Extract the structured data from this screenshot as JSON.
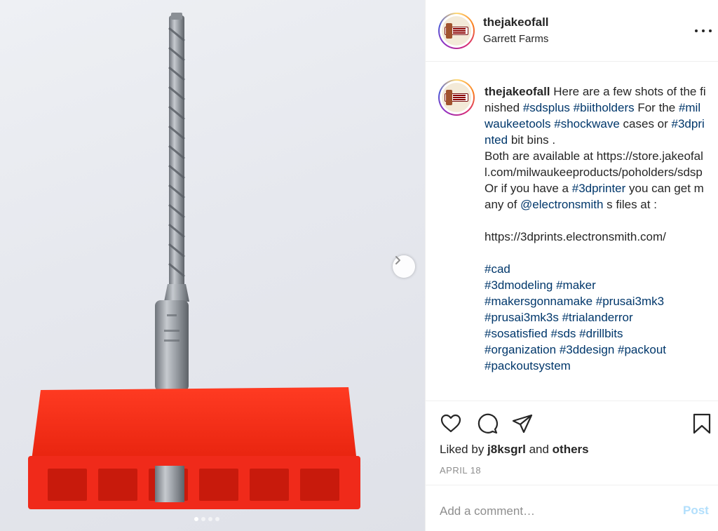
{
  "post": {
    "username": "thejakeofall",
    "location": "Garrett Farms",
    "caption_user": "thejakeofall",
    "caption": [
      {
        "t": " Here are a few shots of the finished "
      },
      {
        "tag": "#sdsplus"
      },
      {
        "t": " "
      },
      {
        "tag": "#biitholders"
      },
      {
        "t": " For the "
      },
      {
        "tag": "#milwaukeetools"
      },
      {
        "t": " "
      },
      {
        "tag": "#shockwave"
      },
      {
        "t": " cases or "
      },
      {
        "tag": "#3dprinted"
      },
      {
        "t": " bit bins .\nBoth are available at https://store.jakeofall.com/milwaukeeproducts/poholders/sdsp\nOr if you have a "
      },
      {
        "tag": "#3dprinter"
      },
      {
        "t": " you can get many of "
      },
      {
        "tag": "@electronsmith"
      },
      {
        "t": " s files at :\n\nhttps://3dprints.electronsmith.com/\n\n"
      },
      {
        "tag": "#cad"
      },
      {
        "t": "\n"
      },
      {
        "tag": "#3dmodeling"
      },
      {
        "t": " "
      },
      {
        "tag": "#maker"
      },
      {
        "t": "\n"
      },
      {
        "tag": "#makersgonnamake"
      },
      {
        "t": " "
      },
      {
        "tag": "#prusai3mk3"
      },
      {
        "t": "\n"
      },
      {
        "tag": "#prusai3mk3s"
      },
      {
        "t": " "
      },
      {
        "tag": "#trialanderror"
      },
      {
        "t": "\n"
      },
      {
        "tag": "#sosatisfied"
      },
      {
        "t": " "
      },
      {
        "tag": "#sds"
      },
      {
        "t": " "
      },
      {
        "tag": "#drillbits"
      },
      {
        "t": "\n"
      },
      {
        "tag": "#organization"
      },
      {
        "t": " "
      },
      {
        "tag": "#3ddesign"
      },
      {
        "t": " "
      },
      {
        "tag": "#packout"
      },
      {
        "t": "\n"
      },
      {
        "tag": "#packoutsystem"
      }
    ],
    "likes": {
      "prefix": "Liked by ",
      "user": "j8ksgrl",
      "middle": " and ",
      "others": "others"
    },
    "date": "APRIL 18",
    "comment_placeholder": "Add a comment…",
    "post_label": "Post"
  },
  "carousel": {
    "slide_count": 4,
    "active_index": 0
  },
  "icons": {
    "like": "heart-icon",
    "comment": "comment-icon",
    "share": "paper-plane-icon",
    "save": "bookmark-icon",
    "more": "more-icon",
    "next": "chevron-right-icon"
  },
  "colors": {
    "link": "#00376b",
    "muted": "#8e8e8e",
    "post_disabled": "#b2dffc",
    "bin_red": "#f02a1a"
  }
}
